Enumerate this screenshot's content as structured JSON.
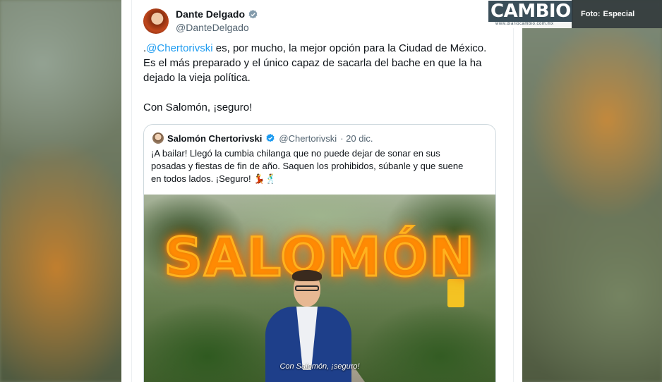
{
  "tweet": {
    "author_name": "Dante Delgado",
    "author_handle": "@DanteDelgado",
    "text_prefix": ".",
    "mention": "@Chertorivski",
    "text_line1_rest": " es, por mucho, la mejor opción para la Ciudad de México.",
    "text_line2": "Es el más preparado y el único capaz de sacarla del bache en que la ha",
    "text_line3": "dejado la vieja política.",
    "text_line4": "Con Salomón, ¡seguro!"
  },
  "quoted_tweet": {
    "author_name": "Salomón Chertorivski",
    "author_handle": "@Chertorivski",
    "date": "· 20 dic.",
    "text_line1": "¡A bailar! Llegó la cumbia chilanga que no puede dejar de sonar en sus",
    "text_line2": "posadas y fiestas de fin de año. Saquen los prohibidos, súbanle y que suene",
    "text_line3": "en todos lados. ¡Seguro! 💃🕺",
    "video_title": "SALOMÓN",
    "video_subtitle": "Con Salomón, ¡seguro!"
  },
  "watermark": {
    "brand": "CAMBIO",
    "brand_sub": "www.diariocambio.com.mx",
    "photo_label": "Foto:",
    "photo_credit": "Especial"
  },
  "colors": {
    "link": "#1d9bf0",
    "verified": "#1d9bf0",
    "text": "#0f1419",
    "secondary_text": "#536471"
  }
}
